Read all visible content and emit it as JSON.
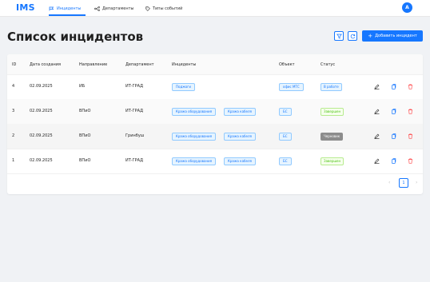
{
  "app": {
    "logo": "IMS",
    "avatar_letter": "A"
  },
  "nav": {
    "incidents": "Инциденты",
    "departments": "Департаменты",
    "event_types": "Типы событий"
  },
  "page": {
    "title": "Список инцидентов",
    "add_button": "Добавить инцидент"
  },
  "table": {
    "columns": {
      "id": "ID",
      "created": "Дата создания",
      "direction": "Направление",
      "department": "Департамент",
      "incidents": "Инциденты",
      "object": "Объект",
      "status": "Статус"
    },
    "rows": [
      {
        "id": "4",
        "created": "02.09.2025",
        "direction": "ИБ",
        "department": "ИТ-ГРАД",
        "incidents": [
          "Поджоги"
        ],
        "object": "офис МТС",
        "status": "В работе"
      },
      {
        "id": "3",
        "created": "02.09.2025",
        "direction": "ВПиО",
        "department": "ИТ-ГРАД",
        "incidents": [
          "Кража оборудования",
          "Кража кабеля"
        ],
        "object": "БС",
        "status": "Завершен"
      },
      {
        "id": "2",
        "created": "02.09.2025",
        "direction": "ВПиО",
        "department": "Гринбуш",
        "incidents": [
          "Кража оборудования",
          "Кража кабеля"
        ],
        "object": "БС",
        "status": "Черновик"
      },
      {
        "id": "1",
        "created": "02.09.2025",
        "direction": "ВПиО",
        "department": "ИТ-ГРАД",
        "incidents": [
          "Кража оборудования",
          "Кража кабеля"
        ],
        "object": "БС",
        "status": "Завершен"
      }
    ]
  },
  "pagination": {
    "current_page": "1",
    "prev": "‹",
    "next": "›"
  },
  "colors": {
    "primary": "#1677ff",
    "status_in_work": "#1677ff",
    "status_done": "#52c41a",
    "status_draft": "#8c8c8c",
    "delete": "#ff4d4f"
  }
}
